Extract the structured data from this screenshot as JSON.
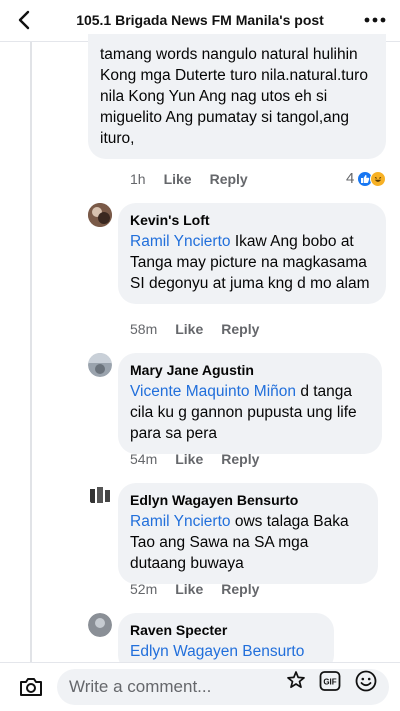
{
  "header": {
    "title": "105.1 Brigada News FM Manila's post"
  },
  "comments": [
    {
      "text_lines": "tamang words nangulo natural hulihin Kong mga Duterte turo nila.natural.turo nila Kong Yun Ang nag utos eh si miguelito Ang pumatay si tangol,ang ituro,",
      "time": "1h",
      "like": "Like",
      "reply": "Reply",
      "reaction_count": "4"
    },
    {
      "name": "Kevin's Loft",
      "tag": "Ramil Yncierto",
      "text": " Ikaw Ang bobo at Tanga may picture na magkasama SI degonyu at juma kng d mo alam",
      "time": "58m",
      "like": "Like",
      "reply": "Reply"
    },
    {
      "name": "Mary Jane Agustin",
      "tag": "Vicente Maquinto Miñon",
      "text": " d tanga cila ku g gannon pupusta ung life para sa pera",
      "time": "54m",
      "like": "Like",
      "reply": "Reply"
    },
    {
      "name": "Edlyn Wagayen Bensurto",
      "tag": "Ramil Yncierto",
      "text": " ows talaga Baka Tao ang Sawa na SA mga dutaang buwaya",
      "time": "52m",
      "like": "Like",
      "reply": "Reply"
    },
    {
      "name": "Raven Specter",
      "tag": "Edlyn Wagayen Bensurto",
      "text": ""
    }
  ],
  "composer": {
    "placeholder": "Write a comment..."
  },
  "icons": {
    "back": "chevron-left-icon",
    "more": "more-dots-icon",
    "camera": "camera-icon",
    "avatar_sticker": "sticker-icon",
    "gif": "gif-icon",
    "emoji": "emoji-icon"
  },
  "colors": {
    "link": "#216fdb",
    "bubble": "#f0f2f5",
    "meta": "#65676b",
    "like_reaction": "#1877f2",
    "haha_reaction": "#f7b125"
  }
}
